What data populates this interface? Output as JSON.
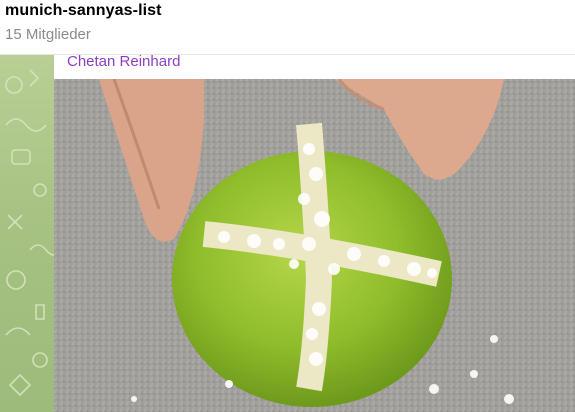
{
  "chat": {
    "title": "munich-sannyas-list",
    "members": "15 Mitglieder"
  },
  "message": {
    "sender": "Chetan Reinhard",
    "sender_color": "#8d3fc0",
    "media_type": "photo"
  },
  "colors": {
    "wallpaper": "#a7c283",
    "lime": "#8dbb2a",
    "salt": "#ffffff"
  },
  "icons": [
    "wallpaper-doodle-icon"
  ]
}
